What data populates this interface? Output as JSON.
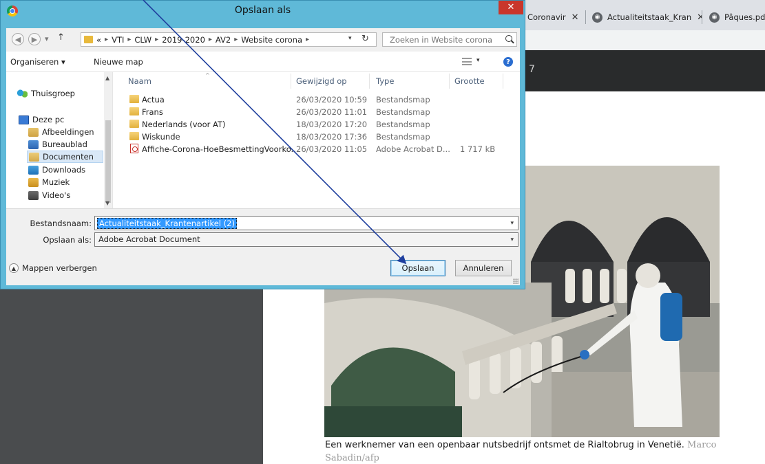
{
  "browser": {
    "tabs": [
      {
        "label": "Coronavir",
        "icon": "document-icon"
      },
      {
        "label": "Actualiteitstaak_Kran",
        "icon": "globe-icon"
      },
      {
        "label": "Pâques.pdf",
        "icon": "globe-icon"
      }
    ],
    "close_glyph": "✕",
    "site_text": "7"
  },
  "article": {
    "caption": "Een werknemer van een openbaar nutsbedrijf ontsmet de Rialtobrug in Venetië.",
    "credit": "Marco Sabadin/afp"
  },
  "dialog": {
    "title": "Opslaan als",
    "close": "✕",
    "breadcrumb": {
      "overflow": "«",
      "parts": [
        "VTI",
        "CLW",
        "2019-2020",
        "AV2",
        "Website corona"
      ]
    },
    "search_placeholder": "Zoeken in Website corona",
    "toolbar": {
      "organize": "Organiseren ▾",
      "new_folder": "Nieuwe map",
      "help": "?"
    },
    "nav": {
      "homegroup": "Thuisgroep",
      "this_pc": "Deze pc",
      "items": [
        "Afbeeldingen",
        "Bureaublad",
        "Documenten",
        "Downloads",
        "Muziek",
        "Video's"
      ],
      "selected": "Documenten"
    },
    "columns": {
      "name": "Naam",
      "modified": "Gewijzigd op",
      "type": "Type",
      "size": "Grootte"
    },
    "files": [
      {
        "name": "Actua",
        "modified": "26/03/2020 10:59",
        "type": "Bestandsmap",
        "size": "",
        "kind": "folder"
      },
      {
        "name": "Frans",
        "modified": "26/03/2020 11:01",
        "type": "Bestandsmap",
        "size": "",
        "kind": "folder"
      },
      {
        "name": "Nederlands (voor AT)",
        "modified": "18/03/2020 17:20",
        "type": "Bestandsmap",
        "size": "",
        "kind": "folder"
      },
      {
        "name": "Wiskunde",
        "modified": "18/03/2020 17:36",
        "type": "Bestandsmap",
        "size": "",
        "kind": "folder"
      },
      {
        "name": "Affiche-Corona-HoeBesmettingVoorko...",
        "modified": "26/03/2020 11:05",
        "type": "Adobe Acrobat D...",
        "size": "1 717 kB",
        "kind": "pdf"
      }
    ],
    "filename_label": "Bestandsnaam:",
    "filename_value": "Actualiteitstaak_Krantenartikel (2)",
    "savetype_label": "Opslaan als:",
    "savetype_value": "Adobe Acrobat Document",
    "hide_folders": "Mappen verbergen",
    "save_button": "Opslaan",
    "cancel_button": "Annuleren"
  },
  "colors": {
    "dialog_frame": "#5fb9d8",
    "close_red": "#c9362b",
    "selection_blue": "#3399ff",
    "annotation_arrow": "#1f3f9e"
  }
}
